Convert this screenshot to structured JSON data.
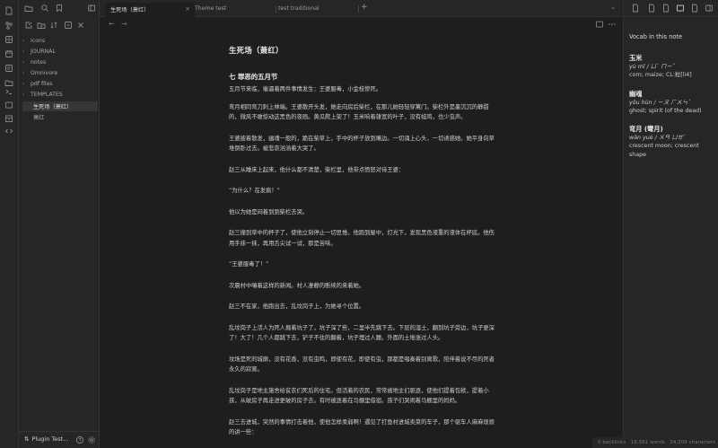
{
  "ribbon": {
    "icons": [
      "files-icon",
      "graph-icon",
      "canvas-icon",
      "calendar-icon",
      "templates-icon",
      "terminal-icon",
      "book-icon",
      "archive-icon",
      "code-icon"
    ]
  },
  "sidebar": {
    "folders": [
      {
        "label": "icons"
      },
      {
        "label": "JOURNAL"
      },
      {
        "label": "notes"
      },
      {
        "label": "Omnivore"
      },
      {
        "label": "pdf files"
      },
      {
        "label": "TEMPLATES"
      }
    ],
    "files": [
      {
        "label": "生死场（萧红）",
        "active": true
      },
      {
        "label": "萧红",
        "active": false
      }
    ],
    "vault_name": "Plugin Test..."
  },
  "tabs": [
    {
      "label": "生死场（萧红）",
      "active": true
    },
    {
      "label": "Theme test",
      "active": false
    },
    {
      "label": "test traditional",
      "active": false
    }
  ],
  "nav": {
    "back": "←",
    "forward": "→"
  },
  "document": {
    "title": "生死场（萧红）",
    "heading": "七  罪恶的五月节",
    "paragraphs": [
      "五月节来临，催逼着两件事情发生：王婆服毒，小金枝惨死。",
      "弯月相同弯刀刺上林端。王婆散开头发，她走向房后柴栏，在那儿她轻轻穿篱门。柴栏外是墨沉沉的静甜的，微风不敢惊动这黑色的夜画。黄瓜爬上架了！玉米响着雄宽的叶子，没有蛙鸣，也少虫声。",
      "王婆披着散发，幽魂一般的，跪在柴草上，手中的杯子放到嘴边。一切涌上心头，一切诱惑她。她平身向草堆倒卧过去。被悲哀汹汹着大哭了。",
      "赵三从睡床上起来，他什么都不清楚，柴栏里，他带点愤怒对待王婆：",
      "“为什么？在发疯！”",
      "他以为她是闷着到到柴栏去哭。",
      "赵三撞到草中的杯子了，使他立刻停止一切思惟。他跑到屋中，灯光下，发现黑色液重的液体在杯底。他伤用手抹一抹，再用舌尖试一试，那是苦味。",
      "“王婆服毒了！”",
      "次晨村中嚷着这样的新闻。村人凄静的断续的来着她。",
      "赵三不在家，他跑出去，乱坟岗子上，为她寻个位置。",
      "乱坟岗子上活人为死人掘着坑子了，坑子深了些，二里半先跳下去。下层的湿土，翻到坑子旁边，坑子更深了！大了！几个人都跳下去，铲子不住的翻着，坑子埋过人腰。外面的土堆涨过人头。",
      "坟场是死的城廓，没有花香，没有虫鸣，即使有花，即使有虫，那都是唱奏着别离歌，陪伴着说不尽的死者永久的寂寞。",
      "乱坟岗子是地主施舍给贫农们死后的住宅。但活着的农民，常常被地主们驱逐，使他们提着包袱，提着小孩，从破房子再走进更破的房子去。有时被逐着在马棚里借宿。孩子们哭闹着马棚里的妈妈。",
      "赵三去进城，突然的事情打击着他，使他怎样柔弱啊！遇见了打鱼村进城卖菜的车子，那个驱车人麻麻烦烦的讲一些："
    ]
  },
  "right_panel": {
    "title": "Vocab in this note",
    "entries": [
      {
        "word": "玉米",
        "pinyin": "yù mǐ / ㄩˋ ㄇㄧˇ",
        "definition": "corn; maize; CL:粒[li4]"
      },
      {
        "word": "幽魂",
        "pinyin": "yōu hún / ㄧㄡ ㄏㄨㄣˊ",
        "definition": "ghost; spirit (of the dead)"
      },
      {
        "word": "弯月 (彎月)",
        "pinyin": "wān yuè / ㄨㄢ ㄩㄝˋ",
        "definition": "crescent moon; crescent shape"
      }
    ]
  },
  "status": {
    "backlinks": "0 backlinks",
    "words": "16,561 words",
    "characters": "24,309 characters"
  },
  "colors": {
    "bg": "#1e1e1e",
    "panel": "#262626",
    "text": "#dcddde",
    "muted": "#8a8a8a"
  }
}
